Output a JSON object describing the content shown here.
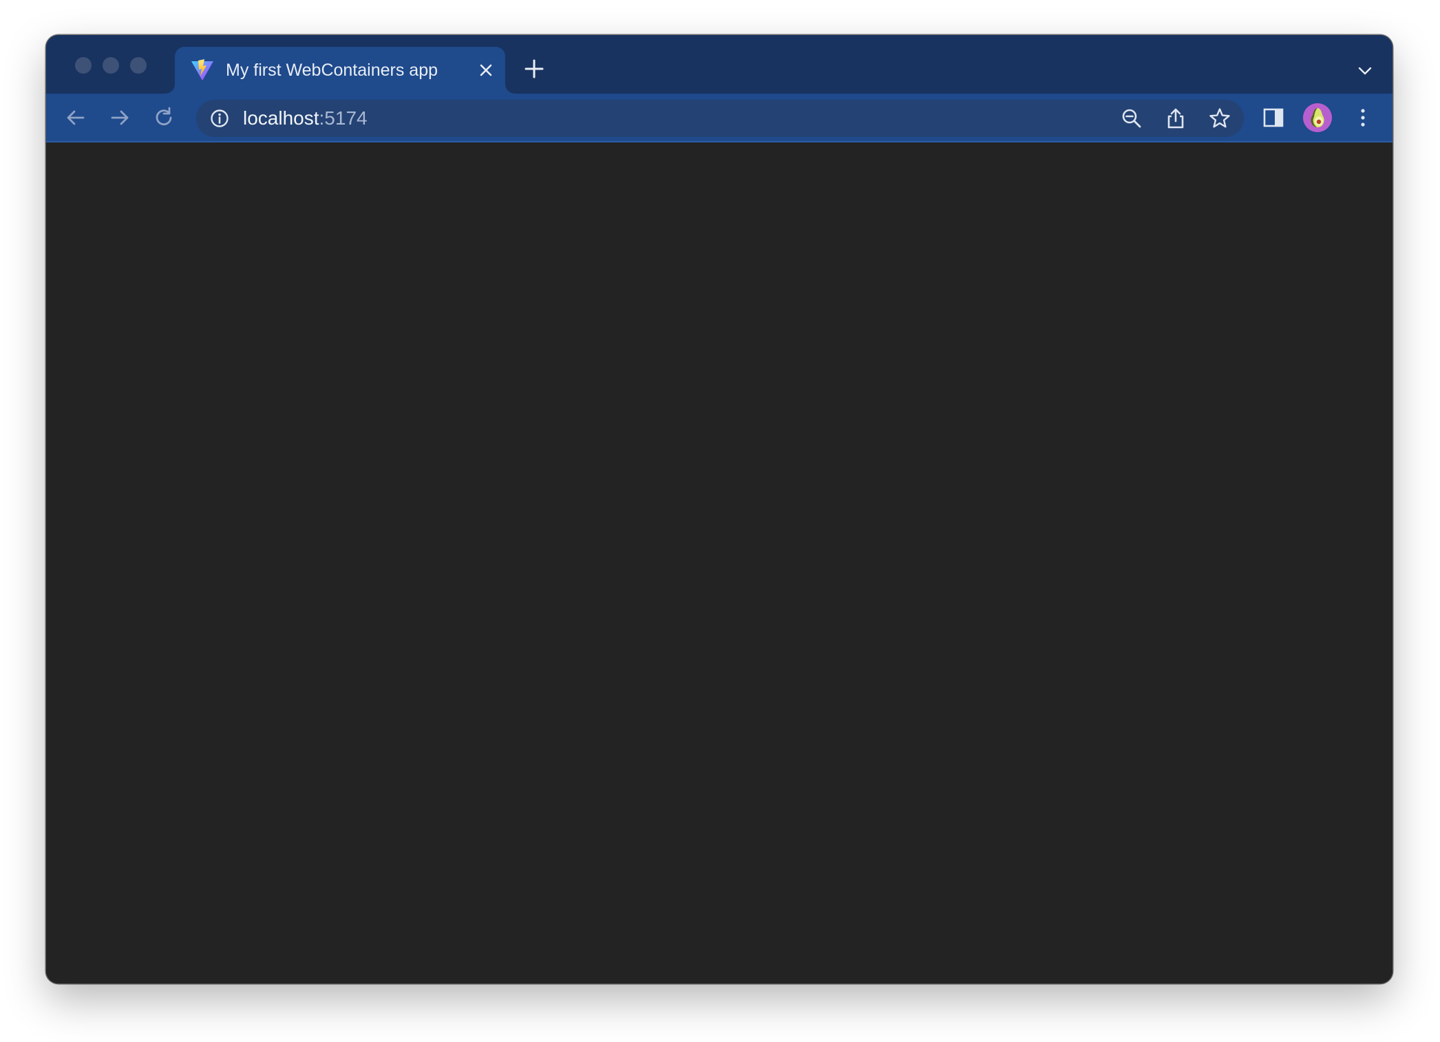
{
  "window": {
    "traffic_lights": [
      "close",
      "minimize",
      "zoom"
    ]
  },
  "tabs": [
    {
      "title": "My first WebContainers app",
      "favicon": "vite-logo-icon",
      "active": true
    }
  ],
  "toolbar": {
    "back_icon": "arrow-left-icon",
    "forward_icon": "arrow-right-icon",
    "reload_icon": "reload-icon"
  },
  "address_bar": {
    "host": "localhost",
    "port": ":5174",
    "site_info_icon": "info-icon",
    "zoom_icon": "zoom-out-icon",
    "share_icon": "share-icon",
    "bookmark_icon": "star-icon"
  },
  "colors": {
    "tabstrip": "#183360",
    "toolbar": "#1f4a8c",
    "omnibox": "#244273",
    "content_background": "#232323"
  },
  "page": {
    "body_text": ""
  }
}
